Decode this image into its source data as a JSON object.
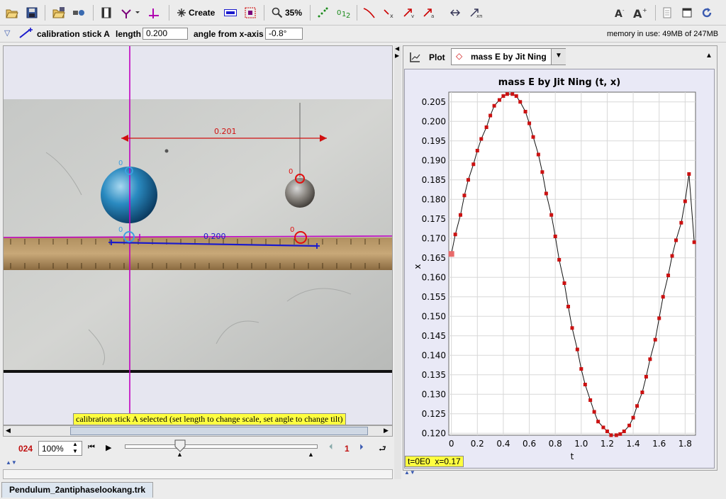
{
  "toolbar": {
    "create_label": "Create",
    "zoom_label": "35%"
  },
  "calibration_bar": {
    "track_name": "calibration stick A",
    "length_label": "length",
    "length_value": "0.200",
    "angle_label": "angle from x-axis",
    "angle_value": "-0.8°",
    "memory_text": "memory in use: 49MB of 247MB"
  },
  "video": {
    "dimension_label": "0.201",
    "stick_label": "0.200",
    "point_label_blue_top": "0",
    "point_label_blue_bottom": "0",
    "point_label_red_top": "0",
    "point_label_red_bottom": "0",
    "status_tooltip": "calibration stick A selected (set length to change scale, set angle to change tilt)"
  },
  "player": {
    "frame_counter": "024",
    "zoom_value": "100%",
    "step_size": "1"
  },
  "plot_panel": {
    "plot_label": "Plot",
    "track_selector": "mass E by Jit Ning",
    "readout": "t=0E0  x=0.17"
  },
  "tab": {
    "filename": "Pendulum_2antiphaselookang.trk"
  },
  "colors": {
    "plot_marker": "#cc1111",
    "calibration": "#1a1acc",
    "axis_line": "#c000c0",
    "tooltip_bg": "#ffff40"
  },
  "chart_data": {
    "type": "line",
    "title": "mass E by Jit Ning (t, x)",
    "xlabel": "t",
    "ylabel": "x",
    "xlim": [
      -0.02,
      1.88
    ],
    "ylim": [
      0.1195,
      0.2075
    ],
    "xticks": [
      "0",
      "0.2",
      "0.4",
      "0.6",
      "0.8",
      "1.0",
      "1.2",
      "1.4",
      "1.6",
      "1.8"
    ],
    "xtick_values": [
      0,
      0.2,
      0.4,
      0.6,
      0.8,
      1.0,
      1.2,
      1.4,
      1.6,
      1.8
    ],
    "yticks": [
      "0.120",
      "0.125",
      "0.130",
      "0.135",
      "0.140",
      "0.145",
      "0.150",
      "0.155",
      "0.160",
      "0.165",
      "0.170",
      "0.175",
      "0.180",
      "0.185",
      "0.190",
      "0.195",
      "0.200",
      "0.205"
    ],
    "ytick_values": [
      0.12,
      0.125,
      0.13,
      0.135,
      0.14,
      0.145,
      0.15,
      0.155,
      0.16,
      0.165,
      0.17,
      0.175,
      0.18,
      0.185,
      0.19,
      0.195,
      0.2,
      0.205
    ],
    "grid": true,
    "series": [
      {
        "x": [
          0.0,
          0.03,
          0.07,
          0.1,
          0.13,
          0.17,
          0.2,
          0.23,
          0.27,
          0.3,
          0.33,
          0.37,
          0.4,
          0.43,
          0.47,
          0.5,
          0.53,
          0.57,
          0.6,
          0.63,
          0.67,
          0.7,
          0.73,
          0.77,
          0.8,
          0.83,
          0.87,
          0.9,
          0.93,
          0.97,
          1.0,
          1.03,
          1.07,
          1.1,
          1.13,
          1.17,
          1.2,
          1.23,
          1.27,
          1.3,
          1.33,
          1.37,
          1.4,
          1.43,
          1.47,
          1.5,
          1.53,
          1.57,
          1.6,
          1.63,
          1.67,
          1.7,
          1.73,
          1.77,
          1.8,
          1.83,
          1.87
        ],
        "y": [
          0.166,
          0.171,
          0.176,
          0.181,
          0.185,
          0.189,
          0.1925,
          0.1955,
          0.1985,
          0.2015,
          0.204,
          0.2055,
          0.2065,
          0.207,
          0.207,
          0.2065,
          0.205,
          0.2025,
          0.1995,
          0.196,
          0.1915,
          0.187,
          0.1815,
          0.176,
          0.1705,
          0.1645,
          0.1585,
          0.1525,
          0.147,
          0.1415,
          0.1365,
          0.1325,
          0.1285,
          0.1255,
          0.123,
          0.1215,
          0.1205,
          0.1195,
          0.1195,
          0.1198,
          0.1205,
          0.122,
          0.124,
          0.127,
          0.1305,
          0.1345,
          0.139,
          0.144,
          0.1495,
          0.155,
          0.1605,
          0.1655,
          0.1695,
          0.174,
          0.1795,
          0.1865,
          0.169
        ]
      }
    ]
  }
}
